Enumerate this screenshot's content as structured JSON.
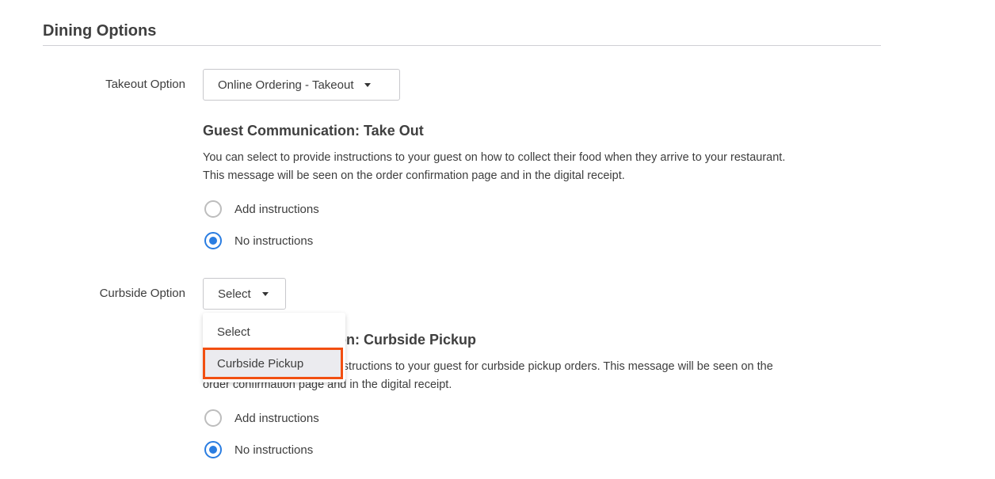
{
  "section": {
    "title": "Dining Options"
  },
  "takeout": {
    "label": "Takeout Option",
    "selected": "Online Ordering - Takeout",
    "guest_comm_title": "Guest Communication: Take Out",
    "description_line1": "You can select to provide instructions to your guest on how to collect their food when they arrive to your restaurant.",
    "description_line2": "This message will be seen on the order confirmation page and in the digital receipt.",
    "radios": [
      {
        "label": "Add instructions",
        "checked": false
      },
      {
        "label": "No instructions",
        "checked": true
      }
    ]
  },
  "curbside": {
    "label": "Curbside Option",
    "selected": "Select",
    "dropdown_open": true,
    "options": [
      {
        "label": "Select",
        "highlighted": false
      },
      {
        "label": "Curbside Pickup",
        "highlighted": true
      }
    ],
    "guest_comm_title": "Guest Communication: Curbside Pickup",
    "description_line1": "You can select to provide instructions to your guest for curbside pickup orders. This message will be seen on the",
    "description_line2": "order confirmation page and in the digital receipt.",
    "radios": [
      {
        "label": "Add instructions",
        "checked": false
      },
      {
        "label": "No instructions",
        "checked": true
      }
    ]
  },
  "colors": {
    "accent": "#2a7de1",
    "highlight_border": "#f24f11"
  }
}
